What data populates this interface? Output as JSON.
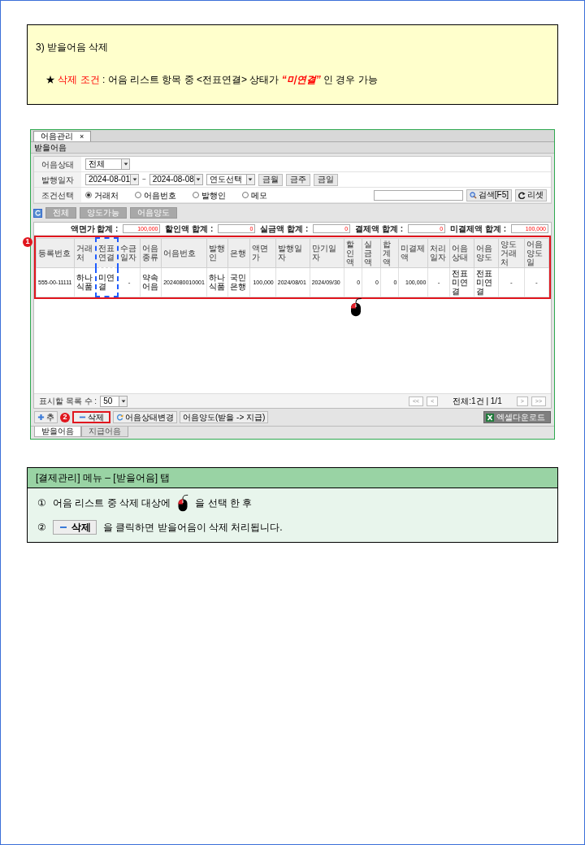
{
  "notice": {
    "title": "3) 받을어음 삭제",
    "condition": [
      {
        "text": "★",
        "kind": "plain"
      },
      {
        "text": "삭제 조건",
        "kind": "red"
      },
      {
        "text": ": 어음 리스트 항목  중 <전표연결> 상태가",
        "kind": "plain"
      },
      {
        "text": "“미연결”",
        "kind": "red_bold"
      },
      {
        "text": "인 경우 가능",
        "kind": "plain"
      }
    ]
  },
  "app": {
    "doc_tab": {
      "label": "어음관리",
      "close": "×"
    },
    "section_title": "받을어음",
    "filters": {
      "status": {
        "label": "어음상태",
        "value": "전체"
      },
      "date": {
        "label": "발행일자",
        "from": "2024-08-01",
        "separator": "~",
        "to": "2024-08-08",
        "year_select": "연도선택",
        "quick": [
          "금월",
          "금주",
          "금일"
        ]
      },
      "condition": {
        "label": "조건선택",
        "options": [
          {
            "label": "거래처",
            "selected": true
          },
          {
            "label": "어음번호",
            "selected": false
          },
          {
            "label": "발행인",
            "selected": false
          },
          {
            "label": "메모",
            "selected": false
          }
        ]
      },
      "search_button": "검색[F5]",
      "reset_button": "리셋"
    },
    "view_buttons": [
      "전체",
      "양도가능",
      "어음양도"
    ],
    "totals": [
      {
        "label": "액면가 합계 :",
        "value": "100,000"
      },
      {
        "label": "할인액 합계 :",
        "value": "0"
      },
      {
        "label": "실금액 합계 :",
        "value": "0"
      },
      {
        "label": "결제액 합계 :",
        "value": "0"
      },
      {
        "label": "미결제액 합계 :",
        "value": "100,000"
      }
    ],
    "row_marker": "1",
    "table": {
      "framed": true,
      "columns": [
        {
          "label": "등록번호",
          "kind": "code",
          "highlighted": false
        },
        {
          "label": "거래처",
          "kind": "text",
          "highlighted": false
        },
        {
          "label": "전표연결",
          "kind": "text",
          "highlighted": true
        },
        {
          "label": "수금일자",
          "kind": "dash",
          "highlighted": false
        },
        {
          "label": "어음종류",
          "kind": "text",
          "highlighted": false
        },
        {
          "label": "어음번호",
          "kind": "code",
          "highlighted": false
        },
        {
          "label": "발행인",
          "kind": "text",
          "highlighted": false
        },
        {
          "label": "은행",
          "kind": "text",
          "highlighted": false
        },
        {
          "label": "액면가",
          "kind": "number",
          "highlighted": false
        },
        {
          "label": "발행일자",
          "kind": "code",
          "highlighted": false
        },
        {
          "label": "만기일자",
          "kind": "code",
          "highlighted": false
        },
        {
          "label": "할인액",
          "kind": "number",
          "highlighted": false
        },
        {
          "label": "실금액",
          "kind": "number",
          "highlighted": false
        },
        {
          "label": "합계액",
          "kind": "number",
          "highlighted": false
        },
        {
          "label": "미결제액",
          "kind": "number",
          "highlighted": false
        },
        {
          "label": "처리일자",
          "kind": "dash",
          "highlighted": false
        },
        {
          "label": "어음상태",
          "kind": "text",
          "highlighted": false
        },
        {
          "label": "어음양도",
          "kind": "text",
          "highlighted": false
        },
        {
          "label": "양도 거래처",
          "kind": "dash",
          "highlighted": false
        },
        {
          "label": "어음양도일",
          "kind": "dash",
          "highlighted": false
        }
      ],
      "rows": [
        {
          "cells": [
            "555-00-11111",
            "하나식품",
            "미연결",
            "-",
            "약속어음",
            "2024080010001",
            "하나식품",
            "국민은행",
            "100,000",
            "2024/08/01",
            "2024/09/30",
            "0",
            "0",
            "0",
            "100,000",
            "-",
            "전표미연결",
            "전표미연결",
            "-",
            "-"
          ]
        }
      ]
    },
    "page_size": {
      "label": "표시할 목록 수 :",
      "value": "50"
    },
    "pager": {
      "first": "<<",
      "prev": "<",
      "info": "전체:1건 | 1/1",
      "next": ">",
      "last": ">>"
    },
    "actions": [
      {
        "label": "추",
        "kind": "add",
        "marked": false
      },
      {
        "label": "삭제",
        "kind": "delete",
        "marked": true
      },
      {
        "label": "어음상태변경",
        "kind": "status",
        "marked": false
      },
      {
        "label": "어음양도(받을 -> 지급)",
        "kind": "transfer",
        "marked": false
      }
    ],
    "action_marker": "2",
    "excel_button": "엑셀다운로드",
    "bottom_tabs": [
      {
        "label": "받을어음",
        "selected": true
      },
      {
        "label": "지급어음",
        "selected": false
      }
    ]
  },
  "guide": {
    "title": "[결제관리] 메뉴 – [받을어음] 탭",
    "steps": [
      {
        "number": "①",
        "kind": "select",
        "before": "어음 리스트 중 삭제 대상에",
        "after": "을  선택 한 후"
      },
      {
        "number": "②",
        "kind": "click",
        "button": "삭제",
        "after": "을 클릭하면 받을어음이 삭제 처리됩니다."
      }
    ]
  }
}
